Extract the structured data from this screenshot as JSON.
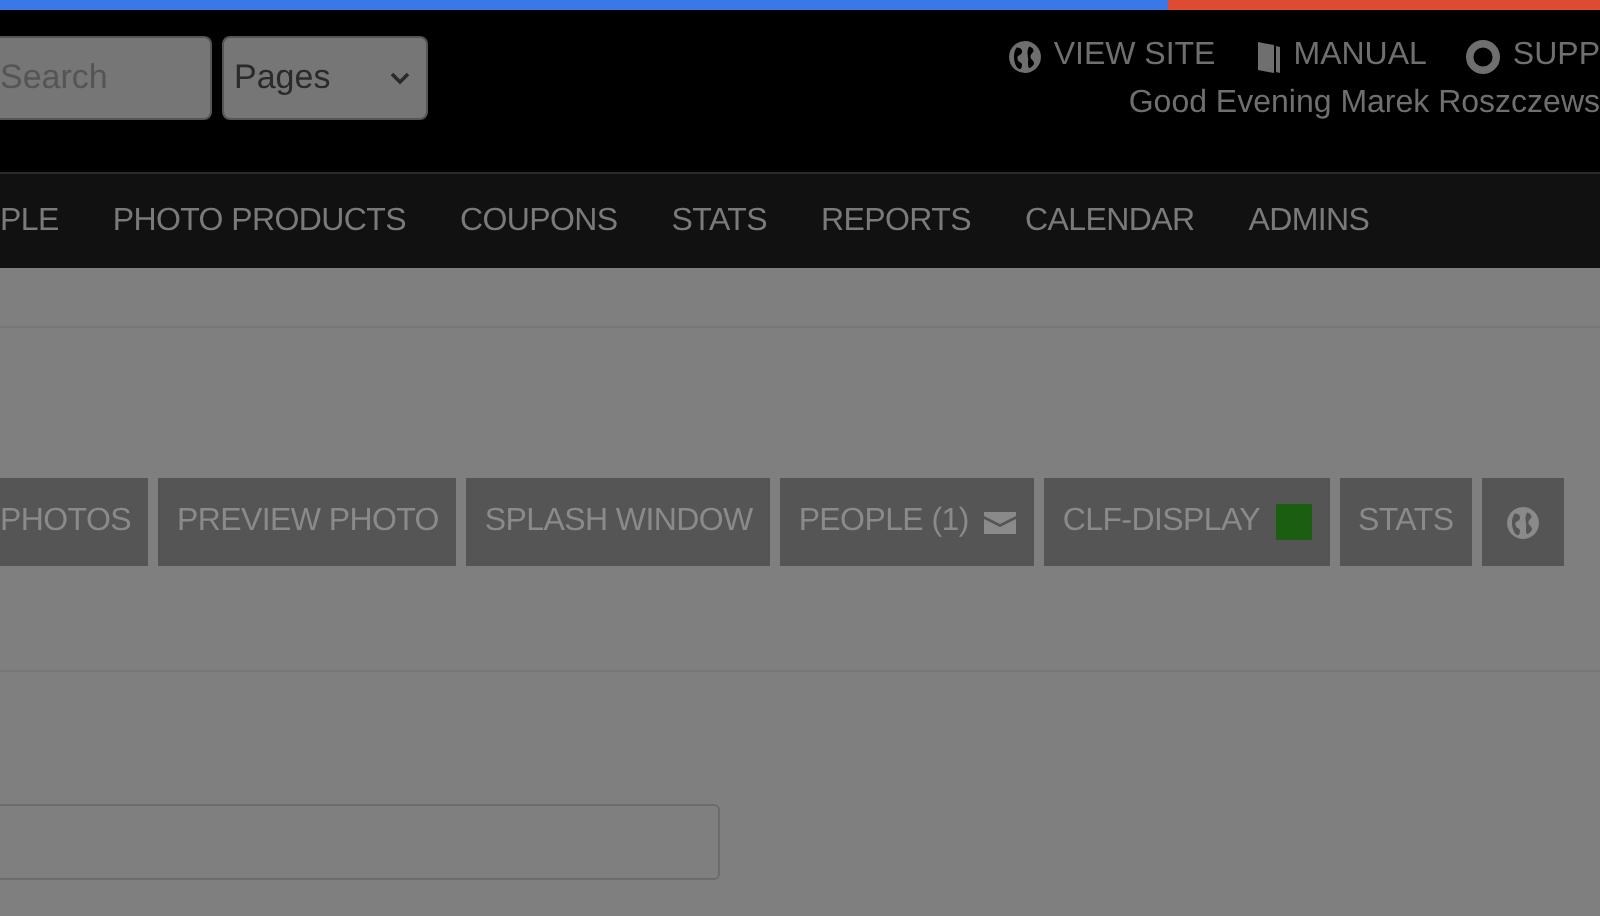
{
  "header": {
    "search": {
      "placeholder": "Search"
    },
    "page_select": {
      "value": "Pages"
    },
    "links": [
      {
        "kind": "globe",
        "label": "VIEW SITE"
      },
      {
        "kind": "book",
        "label": "MANUAL"
      },
      {
        "kind": "lifebuoy",
        "label": "SUPP"
      }
    ],
    "greeting": "Good Evening Marek Roszczews"
  },
  "nav": {
    "items": [
      "PLE",
      "PHOTO PRODUCTS",
      "COUPONS",
      "STATS",
      "REPORTS",
      "CALENDAR",
      "ADMINS"
    ]
  },
  "tabs": [
    {
      "kind": "text",
      "label": "PHOTOS"
    },
    {
      "kind": "text",
      "label": "PREVIEW PHOTO"
    },
    {
      "kind": "text",
      "label": "SPLASH WINDOW"
    },
    {
      "kind": "mail",
      "label": "PEOPLE (1)"
    },
    {
      "kind": "status",
      "label": "CLF-DISPLAY",
      "color": "#1b5e12"
    },
    {
      "kind": "text",
      "label": "STATS"
    },
    {
      "kind": "globe"
    }
  ]
}
